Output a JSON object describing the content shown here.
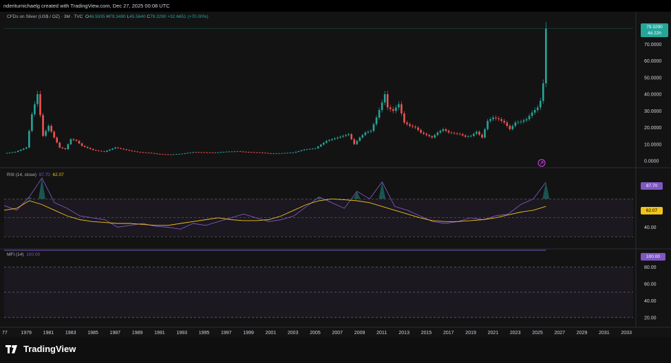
{
  "header": {
    "attribution": "nderitumichaelg created with TradingView.com, Dec 27, 2025 00:08 UTC"
  },
  "symbol": {
    "name": "CFDs on Silver (US$ / OZ) · 3M · TVC",
    "o_label": "O",
    "o": "46.5935",
    "h_label": "H",
    "h": "79.3490",
    "l_label": "L",
    "l": "45.5640",
    "c_label": "C",
    "c": "79.3290",
    "change": "+32.6651 (+70.00%)"
  },
  "price_tag": {
    "value": "79.3290",
    "countdown": "4d 22h"
  },
  "rsi": {
    "label": "RSI (14, close)",
    "value": "87.70",
    "ma_value": "62.07"
  },
  "mfi": {
    "label": "MFI (14)",
    "value": "100.00"
  },
  "brand": {
    "name": "TradingView"
  },
  "colors": {
    "up": "#26a69a",
    "down": "#ef5350",
    "rsi_line": "#7e57c2",
    "rsi_ma": "#f0c419",
    "background": "#131313"
  },
  "chart_data": [
    {
      "type": "candlestick",
      "title": "CFDs on Silver (US$ / OZ) · 3M · TVC",
      "x_ticks": [
        "77",
        "1979",
        "1981",
        "1983",
        "1985",
        "1987",
        "1989",
        "1991",
        "1993",
        "1995",
        "1997",
        "1999",
        "2001",
        "2003",
        "2005",
        "2007",
        "2009",
        "2011",
        "2013",
        "2015",
        "2017",
        "2019",
        "2021",
        "2023",
        "2025",
        "2027",
        "2029",
        "2031",
        "2033"
      ],
      "y_ticks": [
        "70.0000",
        "60.0000",
        "50.0000",
        "40.0000",
        "30.0000",
        "20.0000",
        "10.0000",
        "0.0000"
      ],
      "ylim": [
        0,
        80
      ],
      "series_close_approx": [
        {
          "x": 1977.0,
          "y": 4.5
        },
        {
          "x": 1978.0,
          "y": 5.4
        },
        {
          "x": 1979.0,
          "y": 8
        },
        {
          "x": 1979.5,
          "y": 28
        },
        {
          "x": 1980.0,
          "y": 40
        },
        {
          "x": 1980.5,
          "y": 15
        },
        {
          "x": 1981.0,
          "y": 21
        },
        {
          "x": 1981.5,
          "y": 14
        },
        {
          "x": 1982.0,
          "y": 8
        },
        {
          "x": 1982.5,
          "y": 7
        },
        {
          "x": 1983.0,
          "y": 13
        },
        {
          "x": 1983.5,
          "y": 12
        },
        {
          "x": 1984.0,
          "y": 9
        },
        {
          "x": 1985.0,
          "y": 6.5
        },
        {
          "x": 1986.0,
          "y": 5.5
        },
        {
          "x": 1987.0,
          "y": 8
        },
        {
          "x": 1988.0,
          "y": 6.5
        },
        {
          "x": 1989.0,
          "y": 5.3
        },
        {
          "x": 1990.0,
          "y": 4.8
        },
        {
          "x": 1991.0,
          "y": 4
        },
        {
          "x": 1992.0,
          "y": 3.8
        },
        {
          "x": 1993.0,
          "y": 4.3
        },
        {
          "x": 1994.0,
          "y": 5.2
        },
        {
          "x": 1995.0,
          "y": 5.1
        },
        {
          "x": 1996.0,
          "y": 5
        },
        {
          "x": 1997.0,
          "y": 5.5
        },
        {
          "x": 1998.0,
          "y": 5.7
        },
        {
          "x": 1999.0,
          "y": 5.2
        },
        {
          "x": 2000.0,
          "y": 5
        },
        {
          "x": 2001.0,
          "y": 4.4
        },
        {
          "x": 2002.0,
          "y": 4.6
        },
        {
          "x": 2003.0,
          "y": 5
        },
        {
          "x": 2004.0,
          "y": 6.8
        },
        {
          "x": 2005.0,
          "y": 7.5
        },
        {
          "x": 2006.0,
          "y": 12
        },
        {
          "x": 2007.0,
          "y": 14
        },
        {
          "x": 2008.0,
          "y": 16
        },
        {
          "x": 2008.5,
          "y": 10
        },
        {
          "x": 2009.0,
          "y": 14
        },
        {
          "x": 2009.5,
          "y": 17
        },
        {
          "x": 2010.0,
          "y": 18
        },
        {
          "x": 2010.5,
          "y": 26
        },
        {
          "x": 2011.0,
          "y": 35
        },
        {
          "x": 2011.25,
          "y": 40
        },
        {
          "x": 2011.5,
          "y": 32
        },
        {
          "x": 2012.0,
          "y": 30
        },
        {
          "x": 2012.5,
          "y": 34
        },
        {
          "x": 2013.0,
          "y": 23
        },
        {
          "x": 2013.5,
          "y": 21
        },
        {
          "x": 2014.0,
          "y": 20
        },
        {
          "x": 2014.5,
          "y": 17
        },
        {
          "x": 2015.0,
          "y": 15.5
        },
        {
          "x": 2015.5,
          "y": 14
        },
        {
          "x": 2016.0,
          "y": 17
        },
        {
          "x": 2016.5,
          "y": 19
        },
        {
          "x": 2017.0,
          "y": 17
        },
        {
          "x": 2018.0,
          "y": 16
        },
        {
          "x": 2018.5,
          "y": 14.5
        },
        {
          "x": 2019.0,
          "y": 15
        },
        {
          "x": 2019.5,
          "y": 17.5
        },
        {
          "x": 2020.0,
          "y": 14
        },
        {
          "x": 2020.5,
          "y": 24
        },
        {
          "x": 2021.0,
          "y": 26
        },
        {
          "x": 2021.5,
          "y": 25
        },
        {
          "x": 2022.0,
          "y": 23
        },
        {
          "x": 2022.5,
          "y": 19
        },
        {
          "x": 2023.0,
          "y": 23
        },
        {
          "x": 2023.5,
          "y": 23.5
        },
        {
          "x": 2024.0,
          "y": 25
        },
        {
          "x": 2024.5,
          "y": 29
        },
        {
          "x": 2025.0,
          "y": 32
        },
        {
          "x": 2025.25,
          "y": 36
        },
        {
          "x": 2025.5,
          "y": 46.5
        },
        {
          "x": 2025.75,
          "y": 79.3
        }
      ]
    },
    {
      "type": "line",
      "title": "RSI (14, close)",
      "y_ticks": [
        "40.00"
      ],
      "ylim": [
        20,
        100
      ],
      "series": [
        {
          "name": "RSI",
          "values_approx": [
            63,
            58,
            72,
            92,
            66,
            60,
            52,
            50,
            48,
            40,
            42,
            44,
            41,
            40,
            38,
            44,
            42,
            46,
            50,
            54,
            50,
            46,
            48,
            52,
            62,
            72,
            66,
            60,
            78,
            70,
            88,
            62,
            58,
            52,
            46,
            44,
            46,
            50,
            48,
            52,
            54,
            64,
            70,
            87.7
          ]
        },
        {
          "name": "RSI MA",
          "values_approx": [
            58,
            60,
            68,
            64,
            58,
            52,
            48,
            46,
            45,
            44,
            44,
            43,
            42,
            42,
            44,
            46,
            48,
            50,
            48,
            47,
            47,
            48,
            52,
            58,
            64,
            68,
            70,
            69,
            68,
            66,
            62,
            58,
            54,
            50,
            47,
            46,
            46,
            47,
            48,
            50,
            53,
            56,
            58,
            62.07
          ]
        }
      ]
    },
    {
      "type": "line",
      "title": "MFI (14)",
      "y_ticks": [
        "80.00",
        "60.00",
        "40.00",
        "20.00"
      ],
      "ylim": [
        10,
        100
      ],
      "series": [
        {
          "name": "MFI",
          "values_approx": [
            100,
            100
          ]
        }
      ]
    }
  ]
}
